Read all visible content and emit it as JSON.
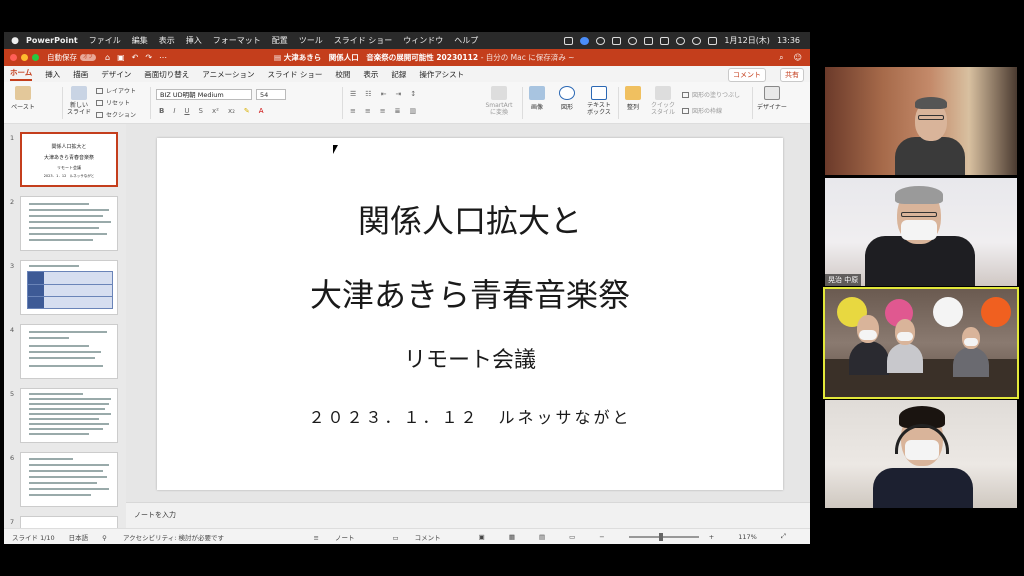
{
  "menubar": {
    "app": "PowerPoint",
    "items": [
      "ファイル",
      "編集",
      "表示",
      "挿入",
      "フォーマット",
      "配置",
      "ツール",
      "スライド ショー",
      "ウィンドウ",
      "ヘルプ"
    ],
    "date": "1月12日(木)",
    "time": "13:36"
  },
  "titlebar": {
    "autosave_label": "自動保存",
    "autosave_state": "オフ",
    "document_title": "大津あきら　関係人口　音楽祭の展開可能性 20230112",
    "save_status": "- 自分の Mac に保存済み ~"
  },
  "ribbon_tabs": [
    "ホーム",
    "挿入",
    "描画",
    "デザイン",
    "画面切り替え",
    "アニメーション",
    "スライド ショー",
    "校閲",
    "表示",
    "記録",
    "操作アシスト"
  ],
  "ribbon_tab_active_index": 0,
  "comment_button": "コメント",
  "share_button": "共有",
  "ribbon": {
    "paste": "ペースト",
    "new_slide": "新しい\nスライド",
    "layout": "レイアウト",
    "reset": "リセット",
    "section": "セクション",
    "font_name": "BIZ UD明朝 Medium",
    "font_size": "54",
    "smartart": "SmartArt\nに変換",
    "picture": "画像",
    "shapes": "図形",
    "textbox": "テキスト\nボックス",
    "arrange": "整列",
    "quick_styles": "クイック\nスタイル",
    "shape_fill": "図形の塗りつぶし",
    "shape_outline": "図形の枠線",
    "designer": "デザイナー"
  },
  "thumbnails": [
    {
      "num": "1",
      "lines": [
        "関係人口拡大と",
        "大津あきら青春音楽祭",
        "リモート会議",
        "2023．1．12　ルネッサながと"
      ]
    },
    {
      "num": "2"
    },
    {
      "num": "3"
    },
    {
      "num": "4"
    },
    {
      "num": "5"
    },
    {
      "num": "6"
    },
    {
      "num": "7"
    }
  ],
  "slide": {
    "title_line1": "関係人口拡大と",
    "title_line2": "大津あきら青春音楽祭",
    "subtitle": "リモート会議",
    "date_line": "２０２３．１．１２　ルネッサながと"
  },
  "notes_placeholder": "ノートを入力",
  "statusbar": {
    "slide_count": "スライド 1/10",
    "language": "日本語",
    "accessibility": "アクセシビリティ: 検討が必要です",
    "notes": "ノート",
    "comments": "コメント",
    "zoom": "117%"
  },
  "participants": [
    {
      "name": ""
    },
    {
      "name": "晃治 中原"
    },
    {
      "name": ""
    },
    {
      "name": ""
    }
  ],
  "colors": {
    "accent": "#c43e1c",
    "active_speaker": "#e2e83a"
  }
}
